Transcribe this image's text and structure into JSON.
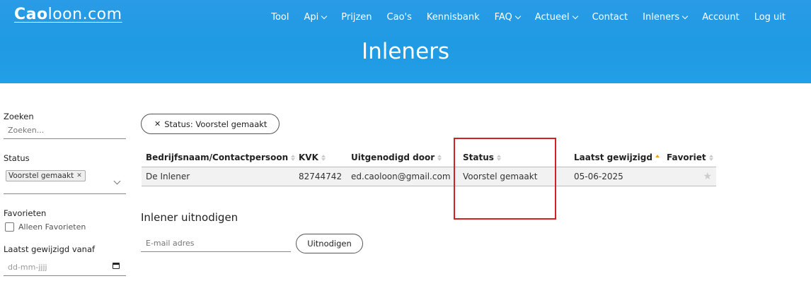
{
  "header": {
    "logo_bold": "Cao",
    "logo_rest": "loon.com",
    "title": "Inleners",
    "nav": [
      {
        "label": "Tool",
        "dropdown": false
      },
      {
        "label": "Api",
        "dropdown": true
      },
      {
        "label": "Prijzen",
        "dropdown": false
      },
      {
        "label": "Cao's",
        "dropdown": false
      },
      {
        "label": "Kennisbank",
        "dropdown": false
      },
      {
        "label": "FAQ",
        "dropdown": true
      },
      {
        "label": "Actueel",
        "dropdown": true
      },
      {
        "label": "Contact",
        "dropdown": false
      },
      {
        "label": "Inleners",
        "dropdown": true
      },
      {
        "label": "Account",
        "dropdown": false
      },
      {
        "label": "Log uit",
        "dropdown": false
      }
    ]
  },
  "sidebar": {
    "search_label": "Zoeken",
    "search_placeholder": "Zoeken...",
    "status_label": "Status",
    "status_chip": "Voorstel gemaakt",
    "favorites_label": "Favorieten",
    "favorites_only": "Alleen Favorieten",
    "date_label": "Laatst gewijzigd vanaf",
    "date_placeholder": "dd-mm-jjjj"
  },
  "filter_pill": "Status: Voorstel gemaakt",
  "table": {
    "headers": [
      "Bedrijfsnaam/Contactpersoon",
      "KVK",
      "Uitgenodigd door",
      "Status",
      "Laatst gewijzigd",
      "Favoriet"
    ],
    "rows": [
      [
        "De Inlener",
        "82744742",
        "ed.caoloon@gmail.com",
        "Voorstel gemaakt",
        "05-06-2025",
        ""
      ]
    ]
  },
  "invite": {
    "title": "Inlener uitnodigen",
    "email_placeholder": "E-mail adres",
    "button": "Uitnodigen"
  },
  "colors": {
    "header_blue": "#1f9ae3",
    "highlight_red": "#d42020",
    "sort_active": "#e8a21c"
  }
}
